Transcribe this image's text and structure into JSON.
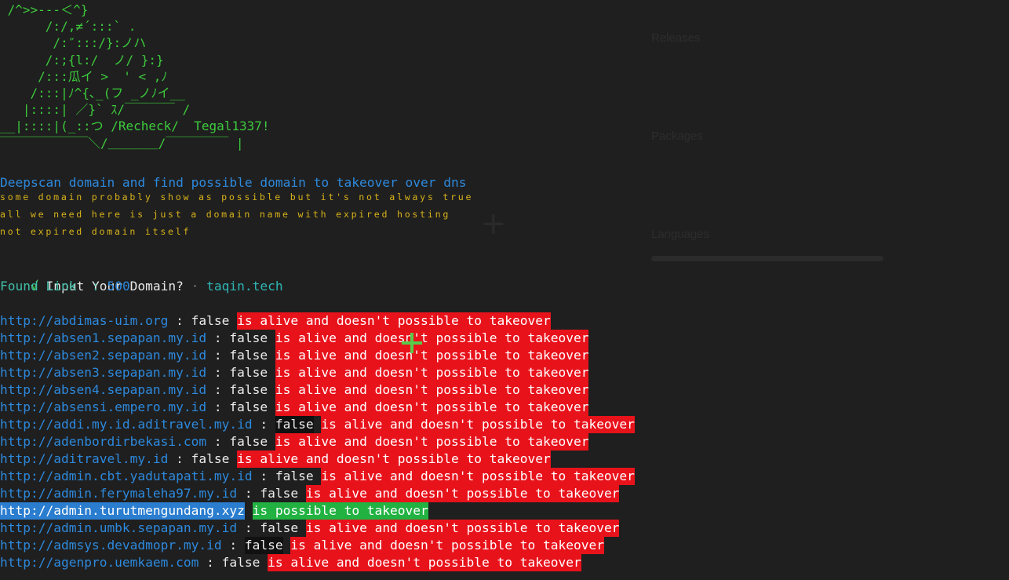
{
  "banner": {
    "ascii": " /^>>---＜^}\n      /:/,≠´:::` .\n       /:″:::/}:ノハ\n      /:;{l:/  ノ/ }:}\n     /:::瓜イ >  ' < ,ﾉ\n    /:::|ﾉ^{､_(フ _ノﾉイ__\n   |::::| ／}` ｽ/￣￣￣￣ /\n__|::::|(_::つ /Recheck/  Tegal1337!\n￣￣￣￣￣￣￣＼/＿＿＿＿/￣￣￣￣￣ |"
  },
  "description": "Deepscan domain and find possible domain to takeover over dns",
  "notes": [
    "some domain probably show as possible but it's not always true",
    "all we need here is just a domain name with expired hosting",
    "not expired domain itself"
  ],
  "prompt": {
    "check": "√",
    "question": "Input Your Domain?",
    "dot": "·",
    "answer": "taqin.tech"
  },
  "found": {
    "label": "Found Link  : ",
    "count": "500"
  },
  "results": [
    {
      "url": "http://abdimas-uim.org",
      "sep": " : ",
      "flag": "false",
      "msg": "is alive and doesn't possible to takeover",
      "status": "alive"
    },
    {
      "url": "http://absen1.sepapan.my.id",
      "sep": " : ",
      "flag": "false",
      "msg": "is alive and doesn't possible to takeover",
      "status": "alive"
    },
    {
      "url": "http://absen2.sepapan.my.id",
      "sep": " : ",
      "flag": "false",
      "msg": "is alive and doesn't possible to takeover",
      "status": "alive"
    },
    {
      "url": "http://absen3.sepapan.my.id",
      "sep": " : ",
      "flag": "false",
      "msg": "is alive and doesn't possible to takeover",
      "status": "alive"
    },
    {
      "url": "http://absen4.sepapan.my.id",
      "sep": " : ",
      "flag": "false",
      "msg": "is alive and doesn't possible to takeover",
      "status": "alive"
    },
    {
      "url": "http://absensi.empero.my.id",
      "sep": " : ",
      "flag": "false",
      "msg": "is alive and doesn't possible to takeover",
      "status": "alive"
    },
    {
      "url": "http://addi.my.id.aditravel.my.id",
      "sep": " : ",
      "flag": "false",
      "msg": "is alive and doesn't possible to takeover",
      "status": "alive",
      "flag_selected": true
    },
    {
      "url": "http://adenbordirbekasi.com",
      "sep": " : ",
      "flag": "false",
      "msg": "is alive and doesn't possible to takeover",
      "status": "alive"
    },
    {
      "url": "http://aditravel.my.id",
      "sep": " : ",
      "flag": "false",
      "msg": "is alive and doesn't possible to takeover",
      "status": "alive"
    },
    {
      "url": "http://admin.cbt.yadutapati.my.id",
      "sep": " : ",
      "flag": "false",
      "msg": "is alive and doesn't possible to takeover",
      "status": "alive"
    },
    {
      "url": "http://admin.ferymaleha97.my.id",
      "sep": " : ",
      "flag": "false",
      "msg": "is alive and doesn't possible to takeover",
      "status": "alive"
    },
    {
      "url": "http://admin.turutmengundang.xyz",
      "sep": " ",
      "flag": "",
      "msg": "is possible to takeover",
      "status": "possible"
    },
    {
      "url": "http://admin.umbk.sepapan.my.id",
      "sep": " : ",
      "flag": "false",
      "msg": "is alive and doesn't possible to takeover",
      "status": "alive"
    },
    {
      "url": "http://admsys.devadmopr.my.id",
      "sep": " : ",
      "flag": "false",
      "msg": "is alive and doesn't possible to takeover",
      "status": "alive",
      "flag_selected": true
    },
    {
      "url": "http://agenpro.uemkaem.com",
      "sep": " : ",
      "flag": "false",
      "msg": "is alive and doesn't possible to takeover",
      "status": "alive"
    }
  ],
  "background_page": {
    "releases": "Releases",
    "packages": "Packages",
    "languages": "Languages"
  }
}
